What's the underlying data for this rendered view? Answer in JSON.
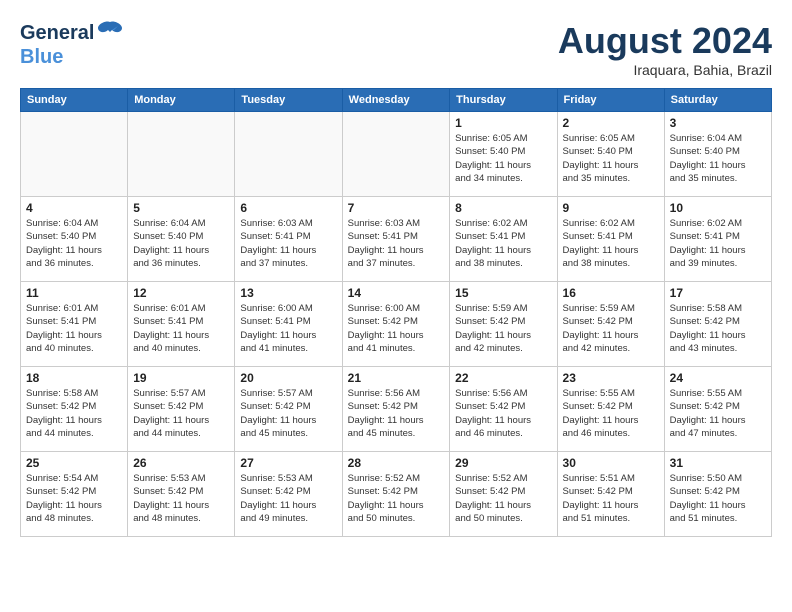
{
  "header": {
    "logo_general": "General",
    "logo_blue": "Blue",
    "month_title": "August 2024",
    "location": "Iraquara, Bahia, Brazil"
  },
  "days_of_week": [
    "Sunday",
    "Monday",
    "Tuesday",
    "Wednesday",
    "Thursday",
    "Friday",
    "Saturday"
  ],
  "weeks": [
    {
      "days": [
        {
          "num": "",
          "info": ""
        },
        {
          "num": "",
          "info": ""
        },
        {
          "num": "",
          "info": ""
        },
        {
          "num": "",
          "info": ""
        },
        {
          "num": "1",
          "info": "Sunrise: 6:05 AM\nSunset: 5:40 PM\nDaylight: 11 hours\nand 34 minutes."
        },
        {
          "num": "2",
          "info": "Sunrise: 6:05 AM\nSunset: 5:40 PM\nDaylight: 11 hours\nand 35 minutes."
        },
        {
          "num": "3",
          "info": "Sunrise: 6:04 AM\nSunset: 5:40 PM\nDaylight: 11 hours\nand 35 minutes."
        }
      ]
    },
    {
      "days": [
        {
          "num": "4",
          "info": "Sunrise: 6:04 AM\nSunset: 5:40 PM\nDaylight: 11 hours\nand 36 minutes."
        },
        {
          "num": "5",
          "info": "Sunrise: 6:04 AM\nSunset: 5:40 PM\nDaylight: 11 hours\nand 36 minutes."
        },
        {
          "num": "6",
          "info": "Sunrise: 6:03 AM\nSunset: 5:41 PM\nDaylight: 11 hours\nand 37 minutes."
        },
        {
          "num": "7",
          "info": "Sunrise: 6:03 AM\nSunset: 5:41 PM\nDaylight: 11 hours\nand 37 minutes."
        },
        {
          "num": "8",
          "info": "Sunrise: 6:02 AM\nSunset: 5:41 PM\nDaylight: 11 hours\nand 38 minutes."
        },
        {
          "num": "9",
          "info": "Sunrise: 6:02 AM\nSunset: 5:41 PM\nDaylight: 11 hours\nand 38 minutes."
        },
        {
          "num": "10",
          "info": "Sunrise: 6:02 AM\nSunset: 5:41 PM\nDaylight: 11 hours\nand 39 minutes."
        }
      ]
    },
    {
      "days": [
        {
          "num": "11",
          "info": "Sunrise: 6:01 AM\nSunset: 5:41 PM\nDaylight: 11 hours\nand 40 minutes."
        },
        {
          "num": "12",
          "info": "Sunrise: 6:01 AM\nSunset: 5:41 PM\nDaylight: 11 hours\nand 40 minutes."
        },
        {
          "num": "13",
          "info": "Sunrise: 6:00 AM\nSunset: 5:41 PM\nDaylight: 11 hours\nand 41 minutes."
        },
        {
          "num": "14",
          "info": "Sunrise: 6:00 AM\nSunset: 5:42 PM\nDaylight: 11 hours\nand 41 minutes."
        },
        {
          "num": "15",
          "info": "Sunrise: 5:59 AM\nSunset: 5:42 PM\nDaylight: 11 hours\nand 42 minutes."
        },
        {
          "num": "16",
          "info": "Sunrise: 5:59 AM\nSunset: 5:42 PM\nDaylight: 11 hours\nand 42 minutes."
        },
        {
          "num": "17",
          "info": "Sunrise: 5:58 AM\nSunset: 5:42 PM\nDaylight: 11 hours\nand 43 minutes."
        }
      ]
    },
    {
      "days": [
        {
          "num": "18",
          "info": "Sunrise: 5:58 AM\nSunset: 5:42 PM\nDaylight: 11 hours\nand 44 minutes."
        },
        {
          "num": "19",
          "info": "Sunrise: 5:57 AM\nSunset: 5:42 PM\nDaylight: 11 hours\nand 44 minutes."
        },
        {
          "num": "20",
          "info": "Sunrise: 5:57 AM\nSunset: 5:42 PM\nDaylight: 11 hours\nand 45 minutes."
        },
        {
          "num": "21",
          "info": "Sunrise: 5:56 AM\nSunset: 5:42 PM\nDaylight: 11 hours\nand 45 minutes."
        },
        {
          "num": "22",
          "info": "Sunrise: 5:56 AM\nSunset: 5:42 PM\nDaylight: 11 hours\nand 46 minutes."
        },
        {
          "num": "23",
          "info": "Sunrise: 5:55 AM\nSunset: 5:42 PM\nDaylight: 11 hours\nand 46 minutes."
        },
        {
          "num": "24",
          "info": "Sunrise: 5:55 AM\nSunset: 5:42 PM\nDaylight: 11 hours\nand 47 minutes."
        }
      ]
    },
    {
      "days": [
        {
          "num": "25",
          "info": "Sunrise: 5:54 AM\nSunset: 5:42 PM\nDaylight: 11 hours\nand 48 minutes."
        },
        {
          "num": "26",
          "info": "Sunrise: 5:53 AM\nSunset: 5:42 PM\nDaylight: 11 hours\nand 48 minutes."
        },
        {
          "num": "27",
          "info": "Sunrise: 5:53 AM\nSunset: 5:42 PM\nDaylight: 11 hours\nand 49 minutes."
        },
        {
          "num": "28",
          "info": "Sunrise: 5:52 AM\nSunset: 5:42 PM\nDaylight: 11 hours\nand 50 minutes."
        },
        {
          "num": "29",
          "info": "Sunrise: 5:52 AM\nSunset: 5:42 PM\nDaylight: 11 hours\nand 50 minutes."
        },
        {
          "num": "30",
          "info": "Sunrise: 5:51 AM\nSunset: 5:42 PM\nDaylight: 11 hours\nand 51 minutes."
        },
        {
          "num": "31",
          "info": "Sunrise: 5:50 AM\nSunset: 5:42 PM\nDaylight: 11 hours\nand 51 minutes."
        }
      ]
    }
  ]
}
